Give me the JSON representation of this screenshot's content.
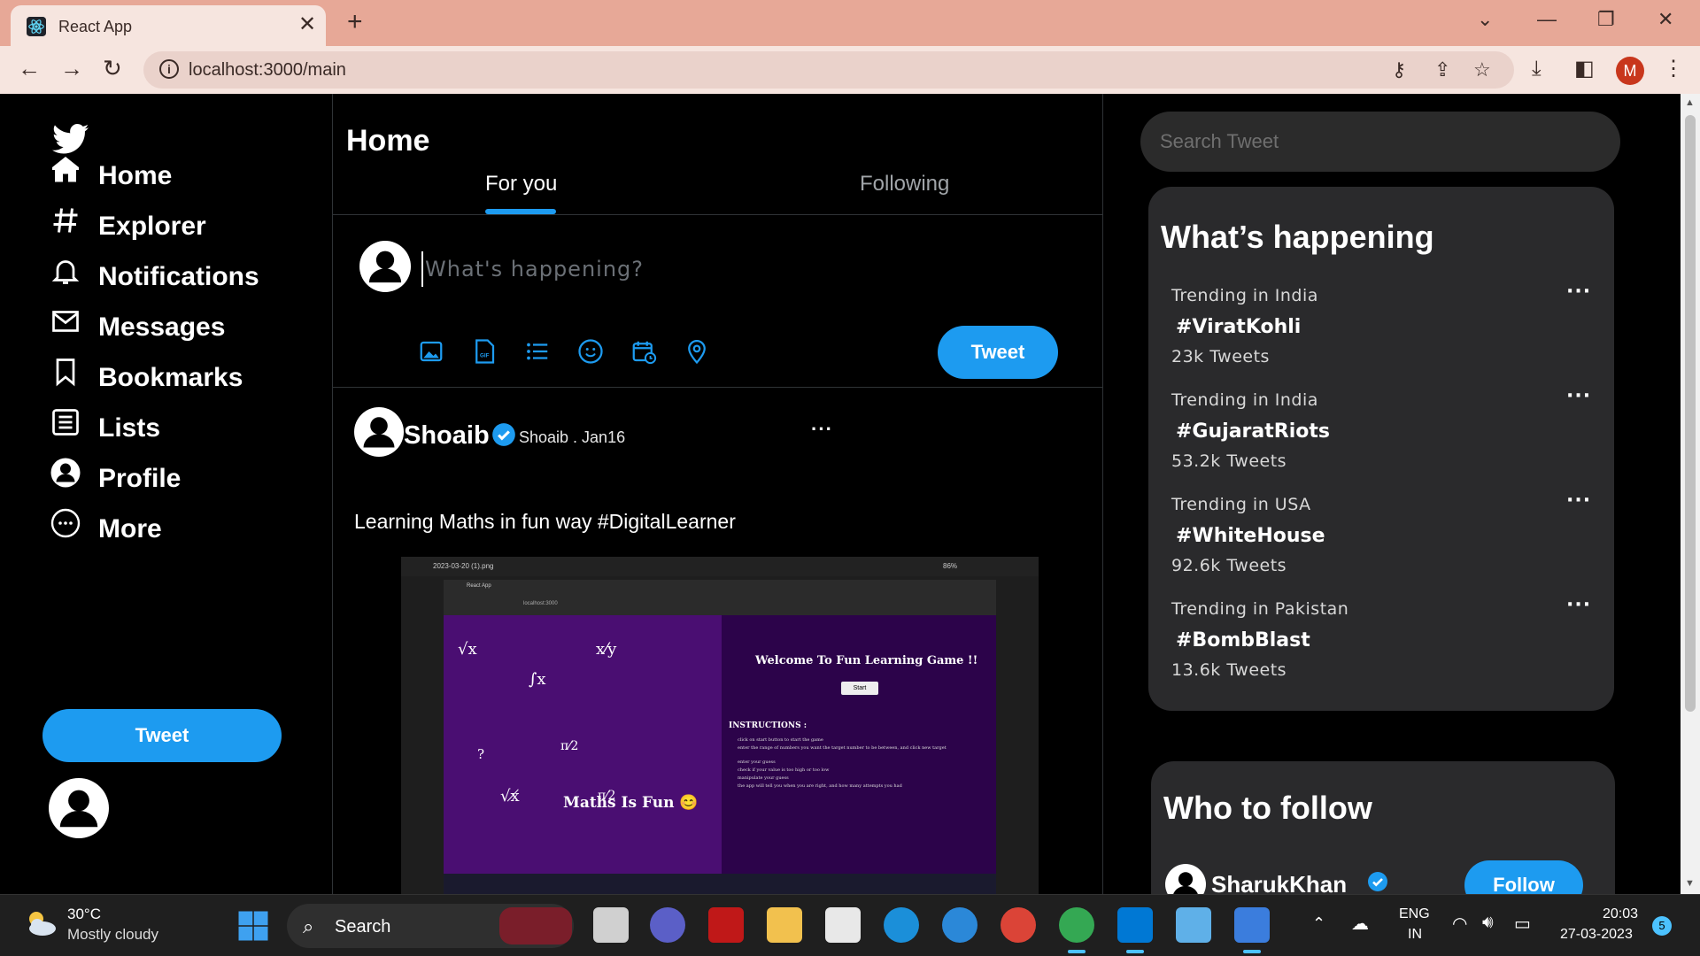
{
  "browser": {
    "tab_title": "React App",
    "tab_close": "✕",
    "new_tab": "+",
    "window_controls": [
      "⌄",
      "—",
      "❐",
      "✕"
    ],
    "url": "localhost:3000/main",
    "profile_initial": "M"
  },
  "sidebar": {
    "items": [
      {
        "label": "Home",
        "icon": "home-icon"
      },
      {
        "label": "Explorer",
        "icon": "hashtag-icon"
      },
      {
        "label": "Notifications",
        "icon": "bell-icon"
      },
      {
        "label": "Messages",
        "icon": "envelope-icon"
      },
      {
        "label": "Bookmarks",
        "icon": "bookmark-icon"
      },
      {
        "label": "Lists",
        "icon": "list-icon"
      },
      {
        "label": "Profile",
        "icon": "profile-icon"
      },
      {
        "label": "More",
        "icon": "more-icon"
      }
    ],
    "tweet_button": "Tweet"
  },
  "feed": {
    "title": "Home",
    "tabs": [
      "For you",
      "Following"
    ],
    "compose_placeholder": "What's happening?",
    "tweet_button": "Tweet",
    "post": {
      "name": "Shoaib",
      "meta": "Shoaib . Jan16",
      "more": "···",
      "text": "Learning Maths in fun way #DigitalLearner",
      "image": {
        "window_title": "2023-03-20 (1).png",
        "zoom": "86%",
        "tab": "React App",
        "url": "localhost:3000",
        "left_title": "Maths Is Fun 😊",
        "right_title": "Welcome To Fun Learning Game !!",
        "start_button": "Start",
        "instructions_title": "INSTRUCTIONS :",
        "instructions": [
          "click on start button to start the game",
          "enter the range of numbers you want the target number to be between, and click new target",
          "enter your guess",
          "check if your value is too high or too low",
          "manipulate your guess",
          "the app will tell you when you are right, and how many attempts you had"
        ],
        "symbols": [
          "√x",
          "x⁄y",
          "∫x",
          "?",
          "π⁄2",
          "√x̸",
          "π⁄2"
        ]
      }
    }
  },
  "right": {
    "search_placeholder": "Search Tweet",
    "trends_title": "What’s happening",
    "trends": [
      {
        "context": "Trending in India",
        "tag": "#ViratKohli",
        "count": "23k Tweets"
      },
      {
        "context": "Trending in India",
        "tag": "#GujaratRiots",
        "count": "53.2k Tweets"
      },
      {
        "context": "Trending in USA",
        "tag": "#WhiteHouse",
        "count": "92.6k Tweets"
      },
      {
        "context": "Trending in Pakistan",
        "tag": "#BombBlast",
        "count": "13.6k Tweets"
      }
    ],
    "trend_more": "···",
    "follow_title": "Who to follow",
    "follow_name": "SharukKhan",
    "follow_button": "Follow"
  },
  "taskbar": {
    "temperature": "30°C",
    "weather": "Mostly cloudy",
    "search": "Search",
    "lang_1": "ENG",
    "lang_2": "IN",
    "time": "20:03",
    "date": "27-03-2023",
    "notifications": "5"
  },
  "colors": {
    "accent": "#1d9bf0",
    "tab_bar": "#e7a897",
    "toolbar": "#f6e5df",
    "card": "#2a2a2c"
  }
}
